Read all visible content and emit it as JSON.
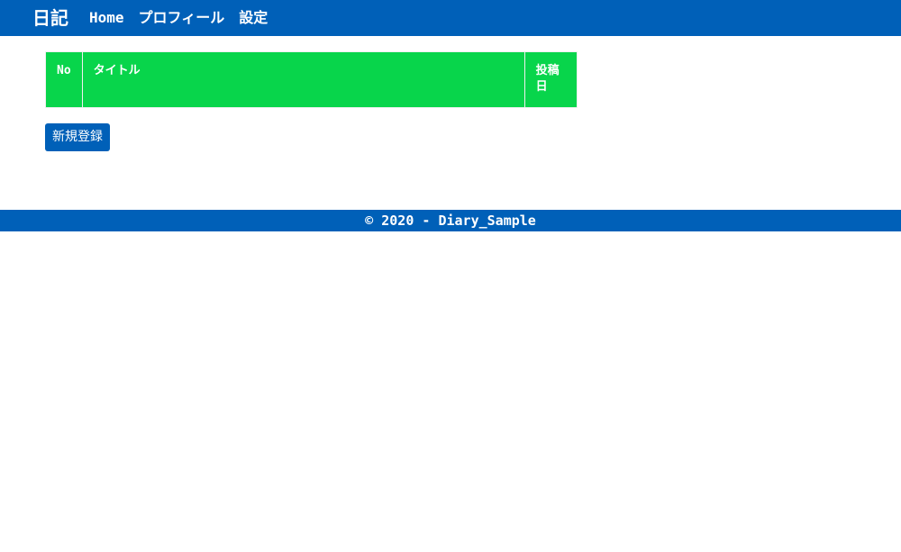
{
  "navbar": {
    "brand": "日記",
    "links": [
      {
        "label": "Home"
      },
      {
        "label": "プロフィール"
      },
      {
        "label": "設定"
      }
    ]
  },
  "table": {
    "headers": [
      "No",
      "タイトル",
      "投稿日"
    ],
    "rows": []
  },
  "actions": {
    "new_button": "新規登録"
  },
  "footer": {
    "text": "© 2020 - Diary_Sample"
  },
  "colors": {
    "primary": "#0060b8",
    "table_header": "#08d54b",
    "text_on_primary": "#ffffff"
  }
}
